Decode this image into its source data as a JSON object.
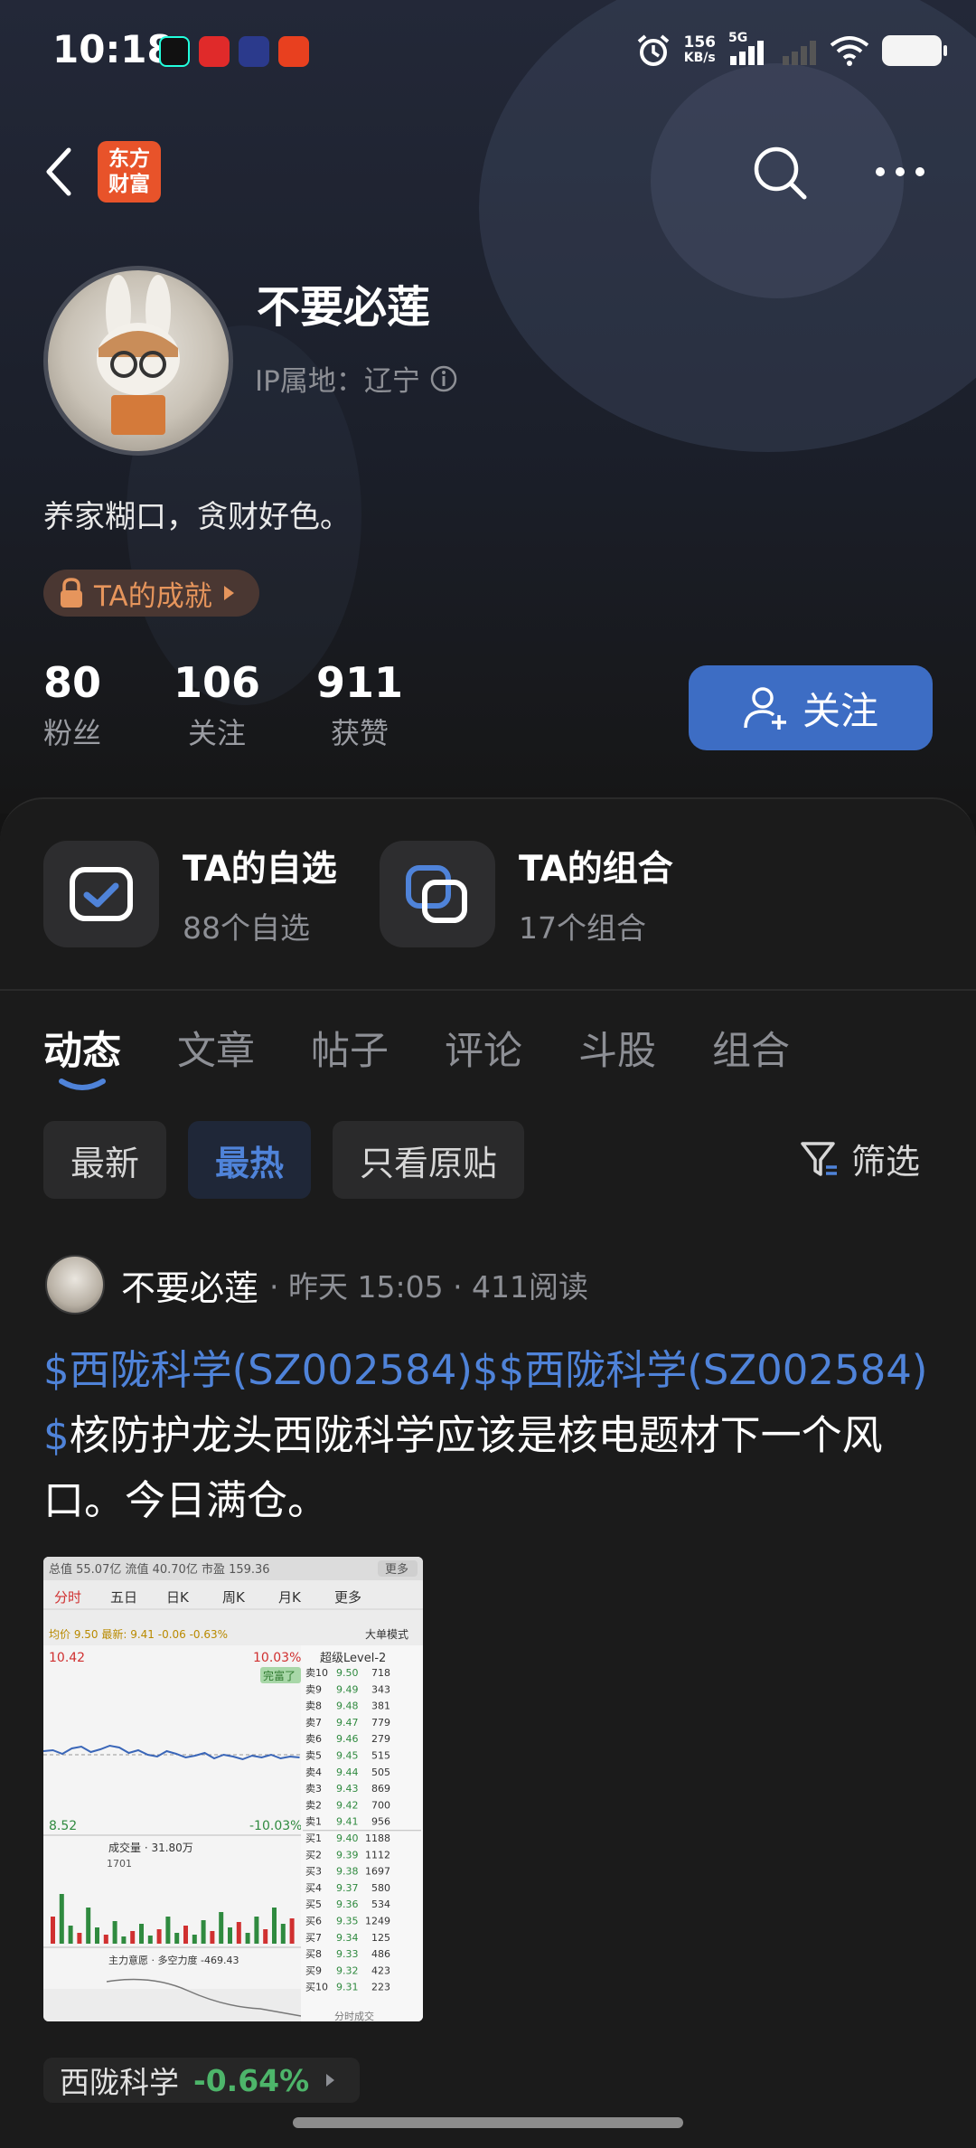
{
  "status_bar": {
    "time": "10:18",
    "net_speed_value": "156",
    "net_speed_unit": "KB/s",
    "network": "5G",
    "icons": [
      "music-app-icon",
      "netease-music-icon",
      "chat-app-icon",
      "taobao-icon",
      "alarm-icon",
      "signal-icon",
      "wifi-icon",
      "battery-icon"
    ]
  },
  "nav": {
    "logo_line1": "东方",
    "logo_line2": "财富",
    "icons": [
      "back-icon",
      "search-icon",
      "more-icon"
    ]
  },
  "profile": {
    "name": "不要必莲",
    "ip_location": "IP属地：辽宁",
    "bio": "养家糊口，贪财好色。",
    "achievement_label": "TA的成就",
    "stats": [
      {
        "value": "80",
        "label": "粉丝"
      },
      {
        "value": "106",
        "label": "关注"
      },
      {
        "value": "911",
        "label": "获赞"
      }
    ],
    "follow_label": "关注"
  },
  "shortcuts": [
    {
      "title": "TA的自选",
      "subtitle": "88个自选",
      "icon": "watchlist-check-icon"
    },
    {
      "title": "TA的组合",
      "subtitle": "17个组合",
      "icon": "portfolio-icon"
    }
  ],
  "tabs": [
    "动态",
    "文章",
    "帖子",
    "评论",
    "斗股",
    "组合"
  ],
  "active_tab": "动态",
  "chips": [
    "最新",
    "最热",
    "只看原贴"
  ],
  "active_chip": "最热",
  "filter_label": "筛选",
  "post": {
    "author": "不要必莲",
    "meta": "· 昨天 15:05 · 411阅读",
    "link1": "$西陇科学(SZ002584)$",
    "link2": "$西陇科学(SZ002584)$",
    "text": "核防护龙头西陇科学应该是核电题材下一个风口。今日满仓。",
    "image": {
      "top_bar": "总值 55.07亿  流值 40.70亿  市盈 159.36",
      "more": "更多",
      "tabs": [
        "分时",
        "五日",
        "日K",
        "周K",
        "月K",
        "更多"
      ],
      "avg_line": "均价 9.50 最新: 9.41 -0.06 -0.63%",
      "big_order": "大单模式",
      "level2": "超级Level-2",
      "high_price": "10.42",
      "high_pct": "10.03%",
      "low_price": "8.52",
      "low_pct": "-10.03%",
      "badge": "完富了",
      "volume": "成交量 · 31.80万",
      "vol_max": "1701",
      "main_force": "主力意愿 · 多空力度 -469.43",
      "sell_book": [
        {
          "label": "卖10",
          "price": "9.50",
          "vol": "718"
        },
        {
          "label": "卖9",
          "price": "9.49",
          "vol": "343"
        },
        {
          "label": "卖8",
          "price": "9.48",
          "vol": "381"
        },
        {
          "label": "卖7",
          "price": "9.47",
          "vol": "779"
        },
        {
          "label": "卖6",
          "price": "9.46",
          "vol": "279"
        },
        {
          "label": "卖5",
          "price": "9.45",
          "vol": "515"
        },
        {
          "label": "卖4",
          "price": "9.44",
          "vol": "505"
        },
        {
          "label": "卖3",
          "price": "9.43",
          "vol": "869"
        },
        {
          "label": "卖2",
          "price": "9.42",
          "vol": "700"
        },
        {
          "label": "卖1",
          "price": "9.41",
          "vol": "956"
        }
      ],
      "buy_book": [
        {
          "label": "买1",
          "price": "9.40",
          "vol": "1188"
        },
        {
          "label": "买2",
          "price": "9.39",
          "vol": "1112"
        },
        {
          "label": "买3",
          "price": "9.38",
          "vol": "1697"
        },
        {
          "label": "买4",
          "price": "9.37",
          "vol": "580"
        },
        {
          "label": "买5",
          "price": "9.36",
          "vol": "534"
        },
        {
          "label": "买6",
          "price": "9.35",
          "vol": "1249"
        },
        {
          "label": "买7",
          "price": "9.34",
          "vol": "125"
        },
        {
          "label": "买8",
          "price": "9.33",
          "vol": "486"
        },
        {
          "label": "买9",
          "price": "9.32",
          "vol": "423"
        },
        {
          "label": "买10",
          "price": "9.31",
          "vol": "223"
        }
      ],
      "bottom": "分时成交"
    },
    "stock_tag_name": "西陇科学",
    "stock_tag_change": "-0.64%"
  },
  "colors": {
    "accent_blue": "#3d6dc4",
    "link_blue": "#4f83d9",
    "down_green": "#4db56a",
    "achievement_orange": "#e6955c",
    "brand_orange": "#e8532a"
  }
}
